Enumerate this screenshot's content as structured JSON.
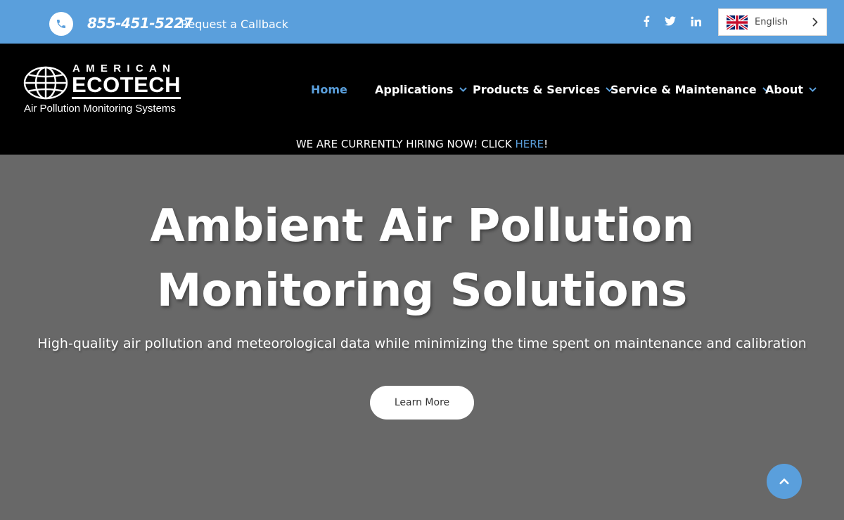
{
  "topbar": {
    "phone": "855-451-5227",
    "callback_label": "Request a Callback",
    "social": [
      "facebook-icon",
      "twitter-icon",
      "linkedin-icon"
    ],
    "language": "English"
  },
  "logo": {
    "line1": "AMERICAN",
    "line2": "ECOTECH",
    "tagline": "Air Pollution Monitoring Systems"
  },
  "nav": {
    "items": [
      {
        "label": "Home",
        "active": true
      },
      {
        "label": "Applications"
      },
      {
        "label": "Products & Services"
      },
      {
        "label": "Service & Maintenance"
      },
      {
        "label": "About"
      }
    ]
  },
  "banner": {
    "text": "WE ARE CURRENTLY HIRING NOW! CLICK ",
    "link": "HERE",
    "after": "!"
  },
  "hero": {
    "title_line1": "Ambient Air Pollution",
    "title_line2": "Monitoring Solutions",
    "subtitle": "High-quality air pollution and meteorological data while minimizing the time spent on maintenance and calibration",
    "cta": "Learn More"
  },
  "colors": {
    "accent": "#5a9fdc",
    "header_bg": "#000000",
    "hero_bg": "#686868"
  }
}
